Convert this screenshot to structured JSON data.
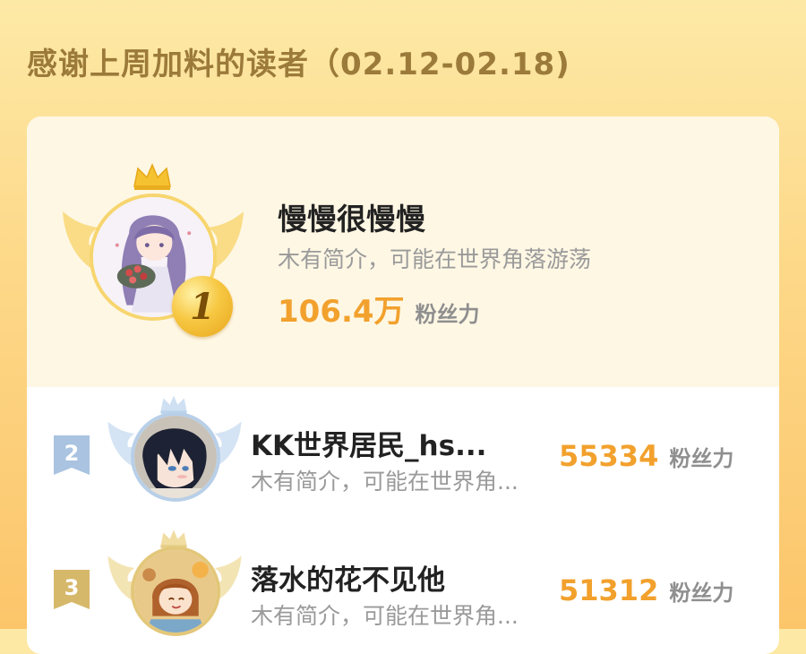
{
  "header": {
    "title": "感谢上周加料的读者（02.12-02.18)"
  },
  "first": {
    "rank": "1",
    "name": "慢慢很慢慢",
    "bio": "木有简介，可能在世界角落游荡",
    "score": "106.4万",
    "score_label": "粉丝力"
  },
  "rows": [
    {
      "rank": "2",
      "name": "KK世界居民_hs...",
      "bio": "木有简介，可能在世界角...",
      "score": "55334",
      "score_label": "粉丝力"
    },
    {
      "rank": "3",
      "name": "落水的花不见他",
      "bio": "木有简介，可能在世界角...",
      "score": "51312",
      "score_label": "粉丝力"
    }
  ],
  "colors": {
    "accent": "#f2a12d",
    "gold": "#f7c843",
    "silver": "#a9c3e0",
    "bronze": "#d6b86a"
  }
}
